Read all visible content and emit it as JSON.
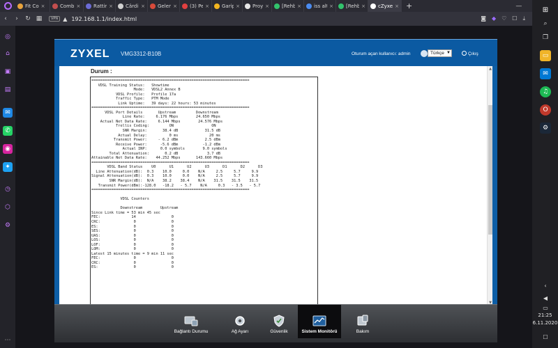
{
  "browser": {
    "tabs": [
      {
        "label": "Fit Co",
        "color": "#e8a33d"
      },
      {
        "label": "Comb",
        "color": "#c24e4e"
      },
      {
        "label": "Ratting",
        "color": "#6b6bd6"
      },
      {
        "label": "Cärdini",
        "color": "#d0d0d0"
      },
      {
        "label": "Gelen",
        "color": "#d84a3a"
      },
      {
        "label": "(3) Pen",
        "color": "#e04040"
      },
      {
        "label": "Garip",
        "color": "#f2b51f"
      },
      {
        "label": "Proyap",
        "color": "#e6e6e6"
      },
      {
        "label": "[Rehb",
        "color": "#32c36c"
      },
      {
        "label": "iss alty",
        "color": "#4a8bf0"
      },
      {
        "label": "[Rehb",
        "color": "#32c36c"
      },
      {
        "label": "cZyxel",
        "color": "#ffffff"
      }
    ],
    "url": "192.168.1.1/index.html",
    "vpn_label": "VPN",
    "new_tab": "+"
  },
  "router": {
    "brand": "ZYXEL",
    "model": "VMG3312-B10B",
    "user_label": "Oturum açan kullanıcı: admin",
    "language": "Türkçe",
    "logout": "Çıkış",
    "section_title": "Durum :",
    "status_text": "=======================================================================\n   VDSL Training Status:   Showtime\n                   Mode:   VDSL2 Annex B\n           VDSL Profile:   Profile 17a\n           Traffic Type:   PTM Mode\n            Link Uptime:   39 days: 22 hours: 53 minutes\n=======================================================================\n      VDSL Port Details       Upstream         Downstream\n              Line Rate:     6.176 Mbps        24.650 Mbps\n    Actual Net Data Rate:     6.144 Mbps        24.576 Mbps\n           Trellis Coding:         ON                 ON\n              SNR Margin:       38.4 dB            31.5 dB\n            Actual Delay:          0 ms              20 ms\n          Transmit Power:     - 6.2 dBm            2.5 dBm\n           Receive Power:      -5.6 dBm           -1.2 dBm\n              Actual INP:      0.0 symbols        9.0 symbols\n        Total Attenuation:       0.2 dB             3.7 dB\nAttainable Net Data Rate:    44.252 Mbps       143.660 Mbps\n=======================================================================\n       VDSL Band Status    U0      U1      U2      U3      D1      D2      D3\n  Line Attenuation(dB):  0.3    10.0     0.0    N/A     2.5     5.7     9.9\nSignal Attenuation(dB):  0.3    10.0     0.0    N/A     2.5     5.7     9.9\n        SNR Margin(dB):  N/A    38.2    38.4    N/A    31.5    31.5    31.5\n   Transmit Power(dBm):-128.0   -18.2   - 5.7    N/A     0.3   - 3.5   - 5.7\n=======================================================================\n\n             VDSL Counters\n\n             Downstream        Upstream\nSince Link time = 53 min 45 sec\nFEC:              14                0\nCRC:               0                0\nES:                0                0\nSES:               0                0\nUAS:               0                0\nLOS:               0                0\nLOF:               0                0\nLOM:               0                0\nLatest 15 minutes time = 9 min 11 sec\nFEC:               0                0\nCRC:               0                0\nES:                0                0",
    "nav": [
      {
        "label": "Bağlantı Durumu",
        "icon": "network-status-icon"
      },
      {
        "label": "Ağ Ayarı",
        "icon": "network-setting-icon"
      },
      {
        "label": "Güvenlik",
        "icon": "security-icon"
      },
      {
        "label": "Sistem Monitörü",
        "icon": "system-monitor-icon"
      },
      {
        "label": "Bakım",
        "icon": "maintenance-icon"
      }
    ],
    "active_nav": "Sistem Monitörü"
  },
  "taskbar": {
    "time": "21:25",
    "date": "6.11.2020"
  }
}
